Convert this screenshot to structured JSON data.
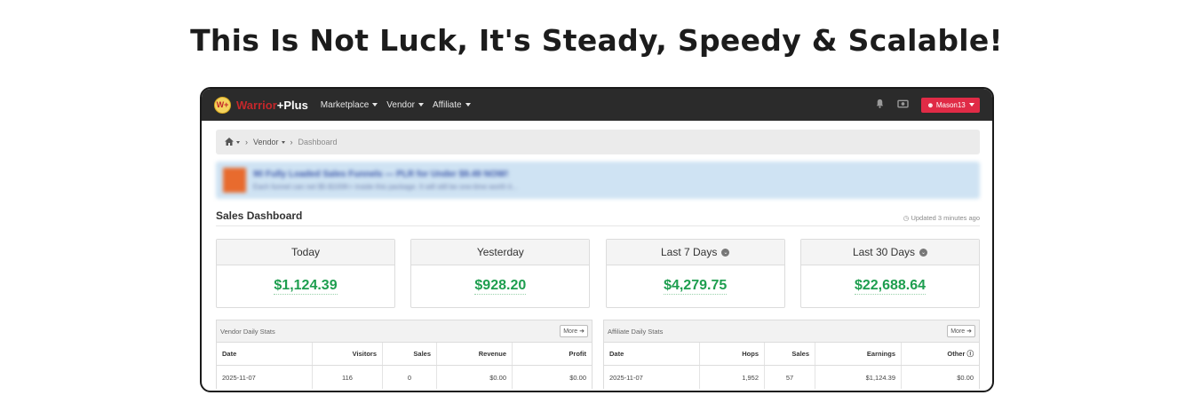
{
  "headline": "This Is Not Luck, It's Steady, Speedy & Scalable!",
  "navbar": {
    "logo_icon": "W+",
    "brand_part1": "Warrior",
    "brand_part2": "+Plus",
    "menu": [
      "Marketplace",
      "Vendor",
      "Affiliate"
    ],
    "bell_icon": "bell-icon",
    "camera_icon": "camera-icon",
    "user_label": "Mason13"
  },
  "breadcrumb": {
    "home_icon": "home-icon",
    "vendor": "Vendor",
    "current": "Dashboard"
  },
  "banner": {
    "title": "90 Fully Loaded Sales Funnels — PLR for Under $9.49 NOW!",
    "subtitle": "Each funnel can net $5-$100K+ inside this package. It will still be one-time worth it..."
  },
  "dashboard": {
    "title": "Sales Dashboard",
    "updated": "Updated 3 minutes ago"
  },
  "cards": [
    {
      "label": "Today",
      "value": "$1,124.39",
      "info": false
    },
    {
      "label": "Yesterday",
      "value": "$928.20",
      "info": false
    },
    {
      "label": "Last 7 Days",
      "value": "$4,279.75",
      "info": true
    },
    {
      "label": "Last 30 Days",
      "value": "$22,688.64",
      "info": true
    }
  ],
  "vendor_stats": {
    "title": "Vendor Daily Stats",
    "more": "More",
    "columns": [
      "Date",
      "Visitors",
      "Sales",
      "Revenue",
      "Profit"
    ],
    "rows": [
      [
        "2025-11-07",
        "116",
        "0",
        "$0.00",
        "$0.00"
      ]
    ]
  },
  "affiliate_stats": {
    "title": "Affiliate Daily Stats",
    "more": "More",
    "columns": [
      "Date",
      "Hops",
      "Sales",
      "Earnings",
      "Other"
    ],
    "rows": [
      [
        "2025-11-07",
        "1,952",
        "57",
        "$1,124.39",
        "$0.00"
      ]
    ]
  },
  "colors": {
    "navbar_bg": "#2b2b2b",
    "brand_red": "#c3272b",
    "user_button": "#e02b46",
    "value_green": "#1e9e4f",
    "banner_bg": "#cfe3f3"
  }
}
